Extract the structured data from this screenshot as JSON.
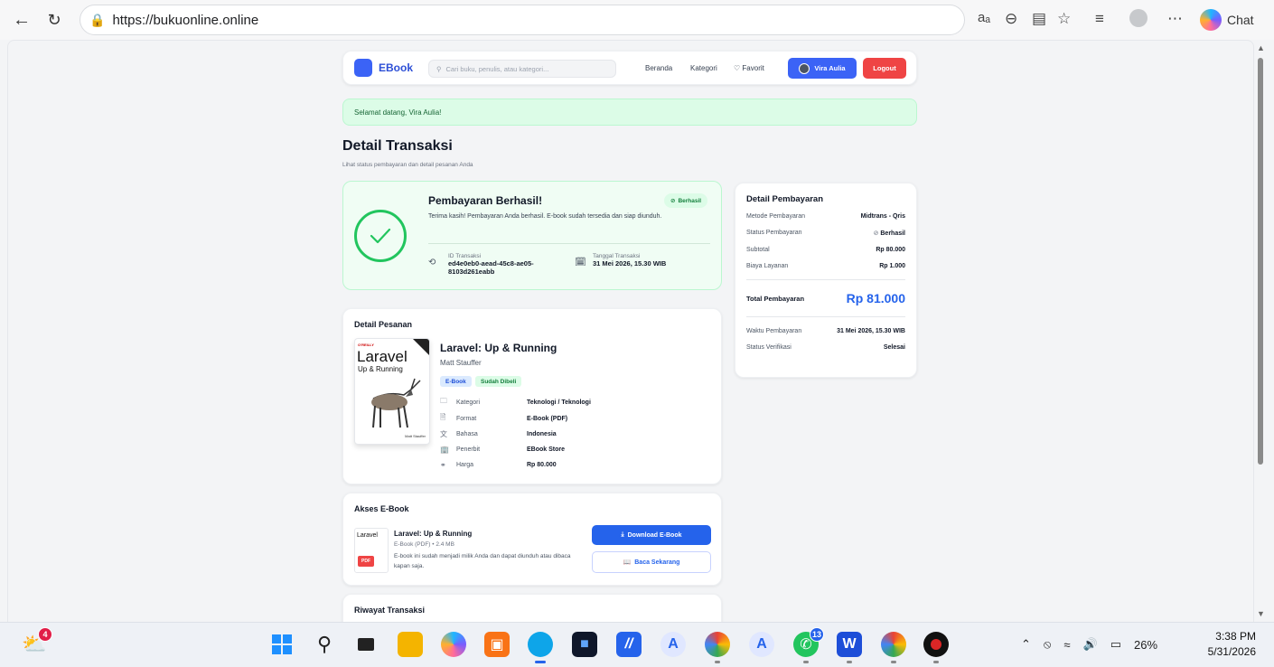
{
  "browser": {
    "url": "https://bukuonline.online",
    "chat_label": "Chat"
  },
  "site": {
    "logo": "EBook",
    "search_placeholder": "Cari buku, penulis, atau kategori...",
    "nav": [
      "Beranda",
      "Kategori",
      "Favorit"
    ],
    "user_name": "Vira Aulia",
    "logout": "Logout"
  },
  "welcome": "Selamat datang, Vira Aulia!",
  "page": {
    "title": "Detail Transaksi",
    "subtitle": "Lihat status pembayaran dan detail pesanan Anda"
  },
  "payment": {
    "title": "Pembayaran Berhasil!",
    "description": "Terima kasih! Pembayaran Anda berhasil. E-book sudah tersedia dan siap diunduh.",
    "badge": "Berhasil",
    "id_label": "ID Transaksi",
    "id_value_1": "ed4e0eb0-aead-45c8-ae05-",
    "id_value_2": "8103d261eabb",
    "date_label": "Tanggal Transaksi",
    "date_value": "31 Mei 2026, 15.30 WIB"
  },
  "payment_detail": {
    "title": "Detail Pembayaran",
    "rows": [
      {
        "label": "Metode Pembayaran",
        "value": "Midtrans - Qris"
      },
      {
        "label": "Status Pembayaran",
        "value": "Berhasil"
      },
      {
        "label": "Subtotal",
        "value": "Rp 80.000"
      },
      {
        "label": "Biaya Layanan",
        "value": "Rp 1.000"
      }
    ],
    "total_label": "Total Pembayaran",
    "total_value": "Rp 81.000",
    "rows2": [
      {
        "label": "Waktu Pembayaran",
        "value": "31 Mei 2026, 15.30 WIB"
      },
      {
        "label": "Status Verifikasi",
        "value": "Selesai"
      }
    ]
  },
  "order": {
    "section_title": "Detail Pesanan",
    "cover_publisher": "O'REILLY",
    "cover_title": "Laravel",
    "cover_subtitle": "Up & Running",
    "cover_author": "Matt Stauffer",
    "book_title": "Laravel: Up & Running",
    "author": "Matt Stauffer",
    "tags": [
      "E-Book",
      "Sudah Dibeli"
    ],
    "attributes": [
      {
        "key": "Kategori",
        "value": "Teknologi / Teknologi",
        "icon": "folder-icon"
      },
      {
        "key": "Format",
        "value": "E-Book (PDF)",
        "icon": "file-icon"
      },
      {
        "key": "Bahasa",
        "value": "Indonesia",
        "icon": "language-icon"
      },
      {
        "key": "Penerbit",
        "value": "EBook Store",
        "icon": "building-icon"
      },
      {
        "key": "Harga",
        "value": "Rp 80.000",
        "icon": "tag-icon"
      }
    ]
  },
  "access": {
    "section_title": "Akses E-Book",
    "title": "Laravel: Up & Running",
    "sub": "E-Book (PDF) • 2.4 MB",
    "desc": "E-book ini sudah menjadi milik Anda dan dapat diunduh atau dibaca kapan saja.",
    "download": "Download E-Book",
    "read": "Baca Sekarang",
    "pdf_label": "PDF"
  },
  "history": {
    "section_title": "Riwayat Transaksi"
  },
  "taskbar": {
    "weather_badge": "4",
    "whatsapp_badge": "13",
    "battery": "26%",
    "time": "3:38 PM",
    "date": "5/31/2026"
  }
}
